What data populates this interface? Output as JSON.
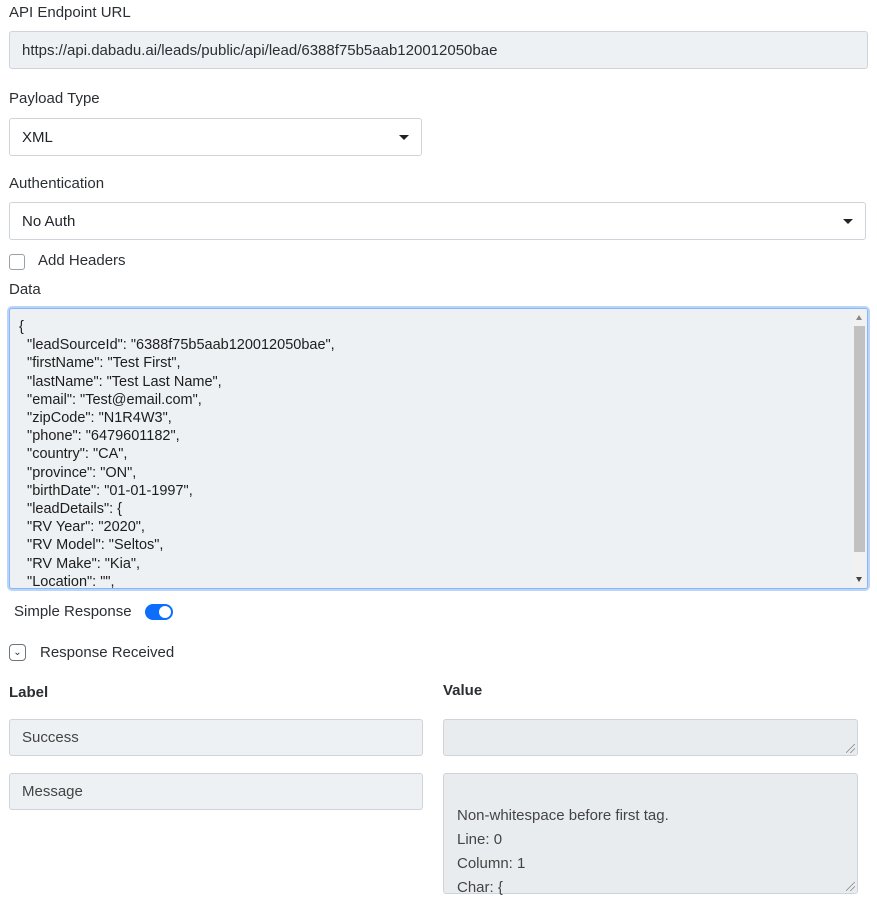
{
  "api": {
    "label": "API Endpoint URL",
    "url": "https://api.dabadu.ai/leads/public/api/lead/6388f75b5aab120012050bae"
  },
  "payload": {
    "label": "Payload Type",
    "selected": "XML"
  },
  "auth": {
    "label": "Authentication",
    "selected": "No Auth"
  },
  "headers": {
    "label": "Add Headers",
    "checked": false
  },
  "data": {
    "label": "Data",
    "lines": [
      "{",
      "  \"leadSourceId\": \"6388f75b5aab120012050bae\",",
      "  \"firstName\": \"Test First\",",
      "  \"lastName\": \"Test Last Name\",",
      "  \"email\": \"Test@email.com\",",
      "  \"zipCode\": \"N1R4W3\",",
      "  \"phone\": \"6479601182\",",
      "  \"country\": \"CA\",",
      "  \"province\": \"ON\",",
      "  \"birthDate\": \"01-01-1997\",",
      "  \"leadDetails\": {",
      "  \"RV Year\": \"2020\",",
      "  \"RV Model\": \"Seltos\",",
      "  \"RV Make\": \"Kia\",",
      "  \"Location\": \"\","
    ]
  },
  "simple_response": {
    "label": "Simple Response",
    "enabled": true
  },
  "response": {
    "label": "Response Received",
    "col_label": "Label",
    "col_value": "Value",
    "rows": [
      {
        "label": "Success",
        "value": ""
      },
      {
        "label": "Message",
        "value": "Non-whitespace before first tag.\nLine: 0\nColumn: 1\nChar: {"
      }
    ]
  },
  "colors": {
    "accent": "#0d6efd",
    "focus_border": "#86b7fe",
    "readonly_bg": "#eef1f4"
  }
}
